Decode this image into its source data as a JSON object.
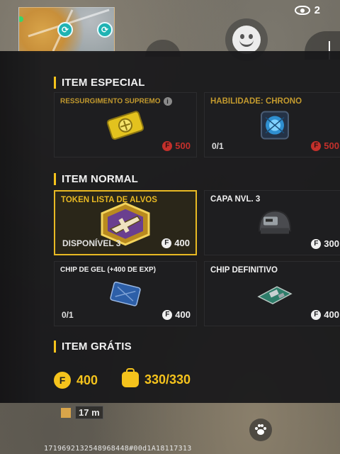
{
  "hud": {
    "spectator_count": "2",
    "distance": "17 m",
    "debug_text": "1719692132548968448#00d1A18117313"
  },
  "sections": {
    "special": {
      "title": "ITEM ESPECIAL",
      "items": [
        {
          "name": "RESSURGIMENTO SUPREMO",
          "price": "500",
          "price_color": "#c3302b"
        },
        {
          "name": "HABILIDADE: CHRONO",
          "count": "0/1",
          "price": "500",
          "price_color": "#c3302b"
        }
      ]
    },
    "normal": {
      "title": "ITEM NORMAL",
      "items": [
        {
          "name": "TOKEN LISTA DE ALVOS",
          "count": "DISPONÍVEL 3",
          "price": "400"
        },
        {
          "name": "CAPA NVL. 3",
          "price": "300"
        },
        {
          "name": "CHIP DE GEL (+400 DE EXP)",
          "count": "0/1",
          "price": "400"
        },
        {
          "name": "CHIP DEFINITIVO",
          "price": "400"
        }
      ]
    },
    "free": {
      "title": "ITEM GRÁTIS"
    }
  },
  "currency": {
    "coins": "400",
    "capacity": "330/330"
  },
  "colors": {
    "accent": "#f5c31c",
    "highlight_border": "#e8b923",
    "unaffordable": "#c3302b"
  },
  "icons": {
    "coin": "F",
    "info": "i"
  }
}
